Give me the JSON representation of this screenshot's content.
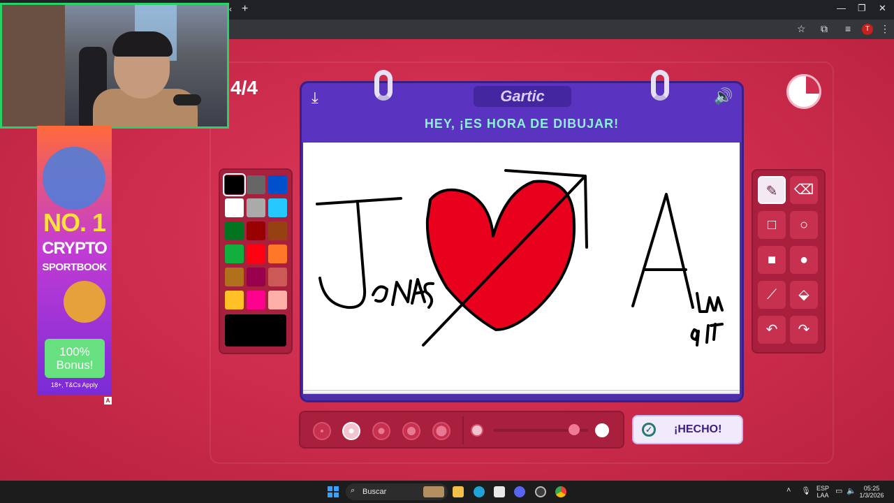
{
  "browser": {
    "new_tab_icon": "plus-icon",
    "profile_initial": "T",
    "toolbar_icons": [
      "star-icon",
      "extensions-icon",
      "media-icon",
      "profile-icon",
      "menu-icon"
    ]
  },
  "game": {
    "round": "4/4",
    "logo": "Gartic",
    "title": "HEY, ¡ES HORA DE DIBUJAR!",
    "done_label": "¡HECHO!",
    "timer_remaining_fraction": 0.75,
    "palette_colors": [
      "#000000",
      "#666666",
      "#0050cd",
      "#ffffff",
      "#aaaaaa",
      "#26c9ff",
      "#017420",
      "#990000",
      "#964112",
      "#11b03c",
      "#ff0013",
      "#ff7829",
      "#b0701c",
      "#99004e",
      "#cb5a57",
      "#ffc126",
      "#ff008f",
      "#feafa8"
    ],
    "selected_color": "#000000",
    "tools": [
      "pencil-icon",
      "eraser-icon",
      "rectangle-outline-icon",
      "circle-outline-icon",
      "rectangle-fill-icon",
      "circle-fill-icon",
      "line-icon",
      "fill-bucket-icon",
      "undo-icon",
      "redo-icon"
    ],
    "brush_sizes": 5,
    "selected_brush_size": 2,
    "opacity_value": 0.85
  },
  "ad": {
    "line1": "NO. 1",
    "line2": "CRYPTO",
    "line3": "SPORTBOOK",
    "bonus": "100% Bonus!",
    "terms": "18+, T&Cs Apply",
    "badge": "A"
  },
  "taskbar": {
    "search_label": "Buscar",
    "lang_top": "ESP",
    "lang_bottom": "LAA",
    "time": "05:25",
    "date": "1/3/2026"
  }
}
